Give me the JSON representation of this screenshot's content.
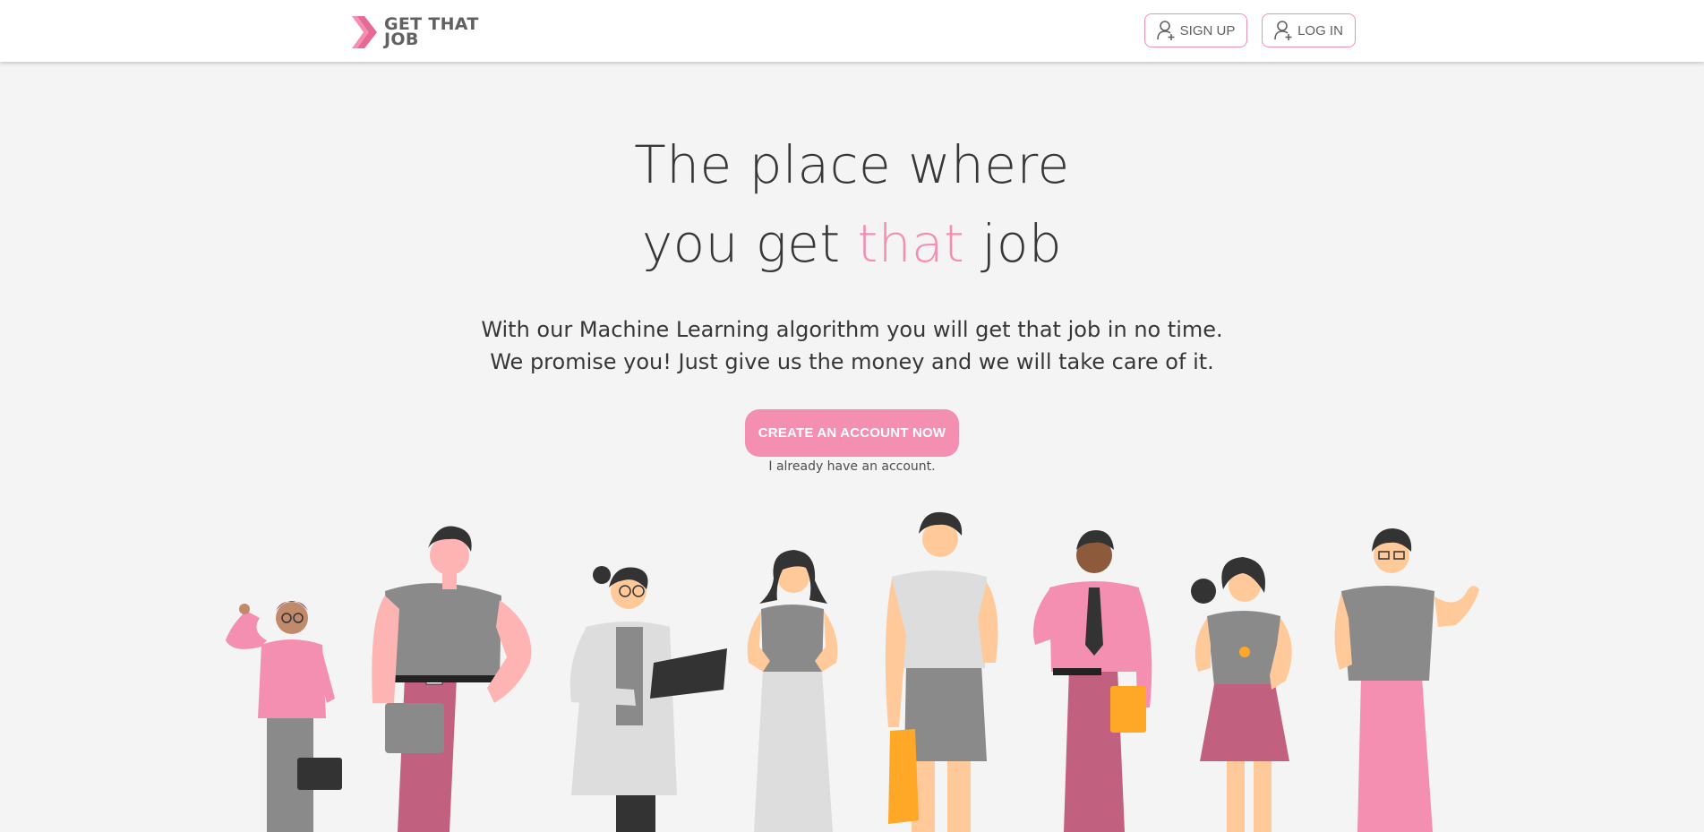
{
  "header": {
    "logo": {
      "line1": "GET THAT",
      "line2": "JOB",
      "icon": "chevron-logo-icon"
    },
    "signup_label": "SIGN UP",
    "login_label": "LOG IN",
    "signup_icon": "user-plus-icon",
    "login_icon": "user-plus-icon"
  },
  "hero": {
    "title_line1": "The place where",
    "title_line2_part1": "you get",
    "title_line2_accent": "that",
    "title_line2_part3": "job",
    "subtitle_line1": "With our Machine Learning algorithm you will get that job in no time.",
    "subtitle_line2": "We promise you! Just give us the money and we will take care of it.",
    "cta_label": "CREATE AN ACCOUNT NOW",
    "login_link": "I already have an account."
  },
  "colors": {
    "accent": "#f48fb1",
    "text": "#373737",
    "background": "#f5f4f4",
    "pink": "#f48fb1",
    "dark_pink": "#c2607f",
    "gray": "#8a8a8a",
    "skin": "#ffc99a"
  }
}
